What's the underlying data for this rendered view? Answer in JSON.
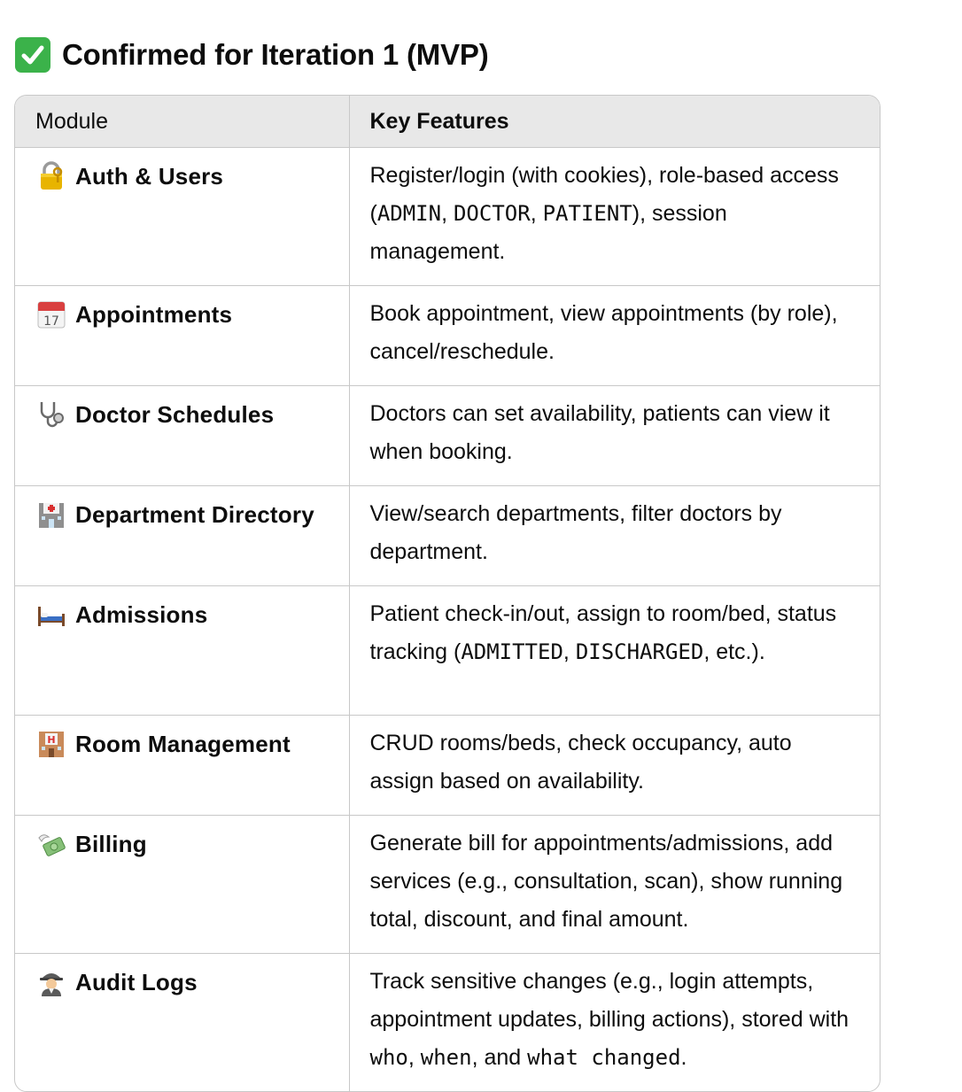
{
  "heading": {
    "icon": "check-mark-button-icon",
    "text": "Confirmed for Iteration 1 (MVP)"
  },
  "table": {
    "headers": {
      "module": "Module",
      "features": "Key Features"
    },
    "rows": [
      {
        "icon": "locked-with-key-icon",
        "module": "Auth & Users",
        "features": {
          "a": "Register/login (with cookies), role-based access (",
          "c1": "ADMIN",
          "b": ", ",
          "c2": "DOCTOR",
          "d": ", ",
          "c3": "PATIENT",
          "e": "), session management."
        }
      },
      {
        "icon": "calendar-icon",
        "module": "Appointments",
        "features": {
          "a": "Book appointment, view appointments (by role), cancel/reschedule."
        }
      },
      {
        "icon": "stethoscope-icon",
        "module": "Doctor Schedules",
        "features": {
          "a": "Doctors can set availability, patients can view it when booking."
        }
      },
      {
        "icon": "hospital-icon",
        "module": "Department Directory",
        "features": {
          "a": "View/search departments, filter doctors by department."
        }
      },
      {
        "icon": "bed-icon",
        "module": "Admissions",
        "features": {
          "a": "Patient check-in/out, assign to room/bed, status tracking (",
          "c1": "ADMITTED",
          "b": ", ",
          "c2": "DISCHARGED",
          "e": ", etc.)."
        }
      },
      {
        "icon": "hotel-icon",
        "module": "Room Management",
        "features": {
          "a": "CRUD rooms/beds, check occupancy, auto assign based on availability."
        }
      },
      {
        "icon": "money-with-wings-icon",
        "module": "Billing",
        "features": {
          "a": "Generate bill for appointments/admissions, add services (e.g., consultation, scan), show running total, discount, and final amount."
        }
      },
      {
        "icon": "detective-icon",
        "module": "Audit Logs",
        "features": {
          "a": "Track sensitive changes (e.g., login attempts, appointment updates, billing actions), stored with ",
          "c1": "who",
          "b": ", ",
          "c2": "when",
          "d": ", and ",
          "c3": "what changed",
          "e": "."
        }
      }
    ]
  },
  "colors": {
    "header_bg": "#e8e8e8",
    "border": "#c8c8c8",
    "check_green": "#3bb24a",
    "text": "#0d0d0d"
  }
}
